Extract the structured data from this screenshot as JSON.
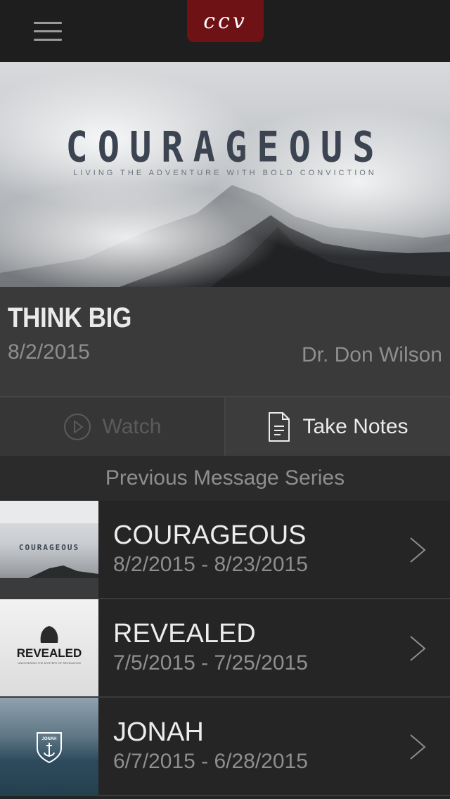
{
  "header": {
    "menu_icon": "hamburger-menu-icon",
    "logo_text": "ccv",
    "logo_color": "#6f1216"
  },
  "hero": {
    "title": "COURAGEOUS",
    "subtitle": "LIVING THE ADVENTURE WITH BOLD CONVICTION"
  },
  "message": {
    "title": "THINK BIG",
    "date": "8/2/2015",
    "speaker": "Dr. Don Wilson"
  },
  "actions": {
    "watch_label": "Watch",
    "watch_icon": "play-circle-icon",
    "notes_label": "Take Notes",
    "notes_icon": "document-icon"
  },
  "previous": {
    "heading": "Previous Message Series",
    "items": [
      {
        "title": "COURAGEOUS",
        "dates": "8/2/2015 - 8/23/2015",
        "thumb_text": "COURAGEOUS"
      },
      {
        "title": "REVEALED",
        "dates": "7/5/2015 - 7/25/2015",
        "thumb_text": "REVEALED",
        "thumb_sub": "UNCOVERING THE MYSTERY OF REVELATION"
      },
      {
        "title": "JONAH",
        "dates": "6/7/2015 - 6/28/2015",
        "thumb_text": "JONAH"
      }
    ]
  }
}
